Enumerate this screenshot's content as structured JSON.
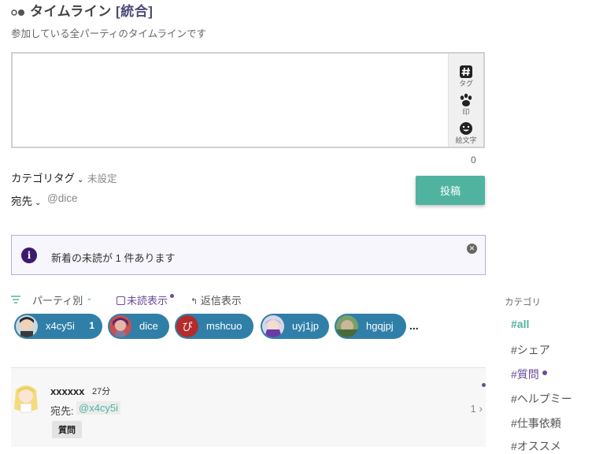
{
  "header": {
    "title": "タイムライン",
    "title_suffix": "[統合]",
    "subtitle": "参加している全パーティのタイムラインです"
  },
  "compose": {
    "placeholder": "",
    "tools": [
      {
        "icon": "hash-icon",
        "label": "タグ"
      },
      {
        "icon": "paw-icon",
        "label": "印"
      },
      {
        "icon": "smiley-icon",
        "label": "絵文字"
      }
    ],
    "char_count": "0",
    "category_tag_label": "カテゴリタグ",
    "category_tag_value": "未設定",
    "destination_label": "宛先",
    "destination_value": "@dice",
    "post_button": "投稿"
  },
  "notice": {
    "message": "新着の未読が 1 件あります",
    "icon": "info-icon"
  },
  "filters": {
    "party_sort": "パーティ別",
    "unread_show": "未読表示",
    "reply_show": "返信表示"
  },
  "parties": [
    {
      "name": "x4cy5i",
      "count": "1"
    },
    {
      "name": "dice",
      "count": ""
    },
    {
      "name": "mshcuo",
      "count": ""
    },
    {
      "name": "uyj1jp",
      "count": ""
    },
    {
      "name": "hgqjpj",
      "count": ""
    }
  ],
  "parties_more": "...",
  "timeline": [
    {
      "user": "xxxxxx",
      "time": "27分",
      "to_label": "宛先:",
      "to_value": "@x4cy5i",
      "tag": "質問",
      "reply_count": "1"
    }
  ],
  "categories": {
    "heading": "カテゴリ",
    "items": [
      {
        "label": "#all",
        "state": "active"
      },
      {
        "label": "#シェア",
        "state": "normal"
      },
      {
        "label": "#質問",
        "state": "unread"
      },
      {
        "label": "#ヘルプミー",
        "state": "normal"
      },
      {
        "label": "#仕事依頼",
        "state": "normal"
      },
      {
        "label": "#オススメ",
        "state": "normal"
      }
    ]
  },
  "colors": {
    "accent": "#4fb3a0",
    "purple": "#6b4b9b",
    "chip": "#2f7fa8"
  }
}
